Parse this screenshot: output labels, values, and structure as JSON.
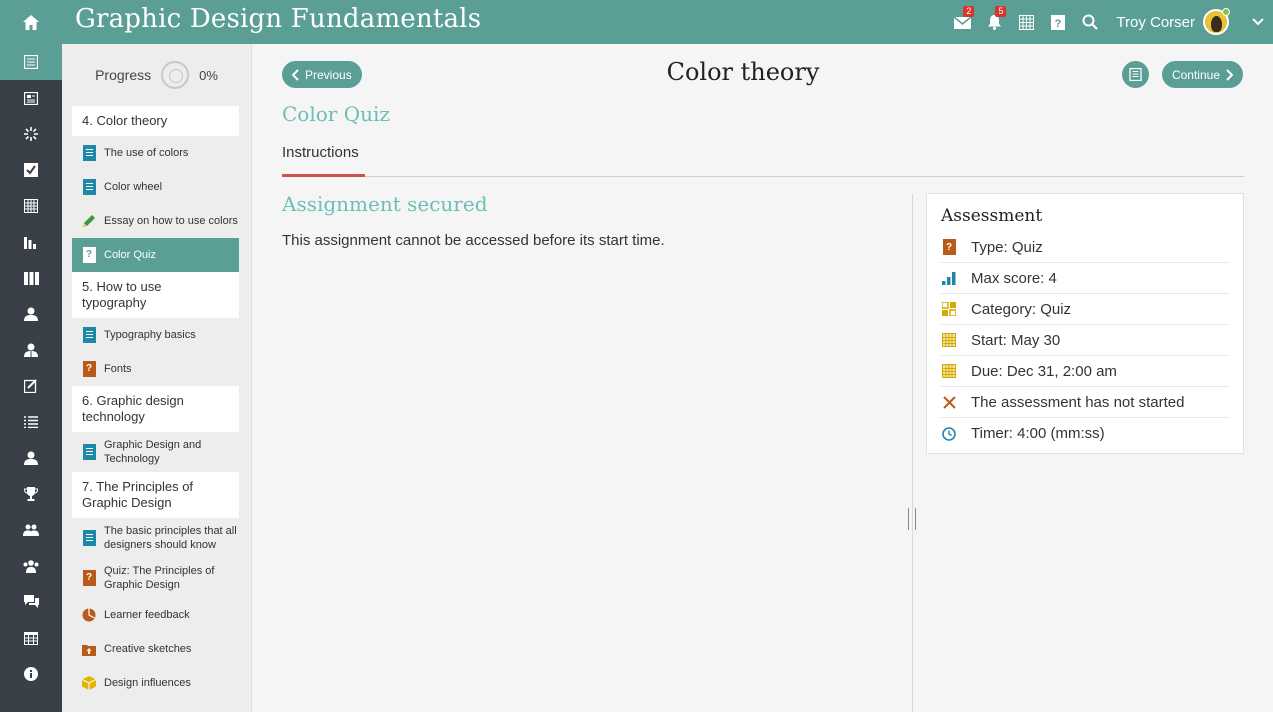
{
  "app": {
    "title": "Graphic Design Fundamentals"
  },
  "topbar": {
    "messages_badge": "2",
    "notifications_badge": "5",
    "user_name": "Troy Corser"
  },
  "rail": {
    "items": [
      "course-contents-icon",
      "course-info-icon",
      "loading-icon",
      "assignments-icon",
      "calendar-icon",
      "reports-icon",
      "library-icon",
      "user-icon",
      "instructor-icon",
      "grades-icon",
      "list-icon",
      "learner-icon",
      "trophy-icon",
      "groups-icon",
      "community-icon",
      "discussions-icon",
      "events-icon",
      "info-icon"
    ]
  },
  "tree": {
    "progress_label": "Progress",
    "progress_value": "0%",
    "sections": [
      {
        "title": "4. Color theory",
        "units": [
          {
            "label": "The use of colors",
            "icon": "document-icon"
          },
          {
            "label": "Color wheel",
            "icon": "document-icon"
          },
          {
            "label": "Essay on how to use colors",
            "icon": "pencil-icon"
          },
          {
            "label": "Color Quiz",
            "icon": "quiz-icon",
            "active": true
          }
        ]
      },
      {
        "title": "5. How to use typography",
        "units": [
          {
            "label": "Typography basics",
            "icon": "document-icon"
          },
          {
            "label": "Fonts",
            "icon": "quiz-icon"
          }
        ]
      },
      {
        "title": "6. Graphic design technology",
        "units": [
          {
            "label": "Graphic Design and Technology",
            "icon": "document-icon"
          }
        ]
      },
      {
        "title": "7. The Principles of Graphic Design",
        "units": [
          {
            "label": "The basic principles that all designers should know",
            "icon": "document-icon"
          },
          {
            "label": "Quiz: The Principles of Graphic Design",
            "icon": "quiz-icon"
          },
          {
            "label": "Learner feedback",
            "icon": "survey-icon"
          },
          {
            "label": "Creative sketches",
            "icon": "upload-icon"
          },
          {
            "label": "Design influences",
            "icon": "package-icon"
          }
        ]
      }
    ]
  },
  "main": {
    "previous_label": "Previous",
    "continue_label": "Continue",
    "unit_title": "Color theory",
    "content_title": "Color Quiz",
    "tab_label": "Instructions",
    "secured_title": "Assignment secured",
    "secured_message": "This assignment cannot be accessed before its start time."
  },
  "assessment": {
    "title": "Assessment",
    "type": "Type: Quiz",
    "max_score": "Max score: 4",
    "category": "Category: Quiz",
    "start": "Start: May 30",
    "due": "Due: Dec 31, 2:00 am",
    "status": "The assessment has not started",
    "timer": "Timer: 4:00 (mm:ss)"
  },
  "colors": {
    "teal": "#5b9e96",
    "teal_light": "#6bbfb6",
    "rail": "#394048",
    "accent_red": "#c9524a",
    "badge_red": "#d9352b",
    "quiz_orange": "#b85b1a",
    "doc_blue": "#1e88a8"
  }
}
